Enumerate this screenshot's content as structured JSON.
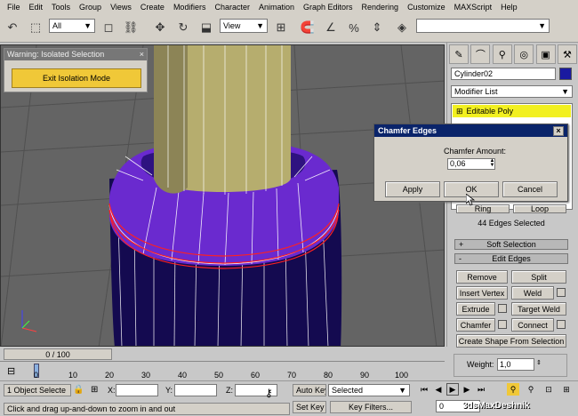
{
  "menu": [
    "File",
    "Edit",
    "Tools",
    "Group",
    "Views",
    "Create",
    "Modifiers",
    "Character",
    "Animation",
    "Graph Editors",
    "Rendering",
    "Customize",
    "MAXScript",
    "Help"
  ],
  "toolbar": {
    "selection_filter": "All",
    "ref_coord": "View"
  },
  "warning": {
    "title": "Warning: Isolated Selection",
    "button": "Exit Isolation Mode"
  },
  "dialog": {
    "title": "Chamfer Edges",
    "amount_label": "Chamfer Amount:",
    "amount_value": "0,06",
    "apply": "Apply",
    "ok": "OK",
    "cancel": "Cancel"
  },
  "command_panel": {
    "object_name": "Cylinder02",
    "object_color": "#1a1aa0",
    "modifier_list": "Modifier List",
    "stack_item": "Editable Poly",
    "ring_label": "Ring",
    "loop_label": "Loop",
    "edges_selected": "44 Edges Selected",
    "soft_selection": "Soft Selection",
    "edit_edges": "Edit Edges",
    "buttons": {
      "remove": "Remove",
      "split": "Split",
      "insert_vertex": "Insert Vertex",
      "weld": "Weld",
      "extrude": "Extrude",
      "target_weld": "Target Weld",
      "chamfer": "Chamfer",
      "connect": "Connect",
      "create_shape": "Create Shape From Selection"
    },
    "weight_label": "Weight:",
    "weight_value": "1,0"
  },
  "timeline": {
    "slider": "0 / 100",
    "ticks": [
      "0",
      "10",
      "20",
      "30",
      "40",
      "50",
      "60",
      "70",
      "80",
      "90",
      "100"
    ]
  },
  "status": {
    "selected": "1 Object Selecte",
    "x_label": "X:",
    "y_label": "Y:",
    "z_label": "Z:",
    "prompt": "Click and drag up-and-down to zoom in and out",
    "auto_key": "Auto Key",
    "set_key": "Set Key",
    "key_mode": "Selected",
    "key_filters": "Key Filters...",
    "frame": "0"
  },
  "watermark": "3dsMaxDeshnik"
}
